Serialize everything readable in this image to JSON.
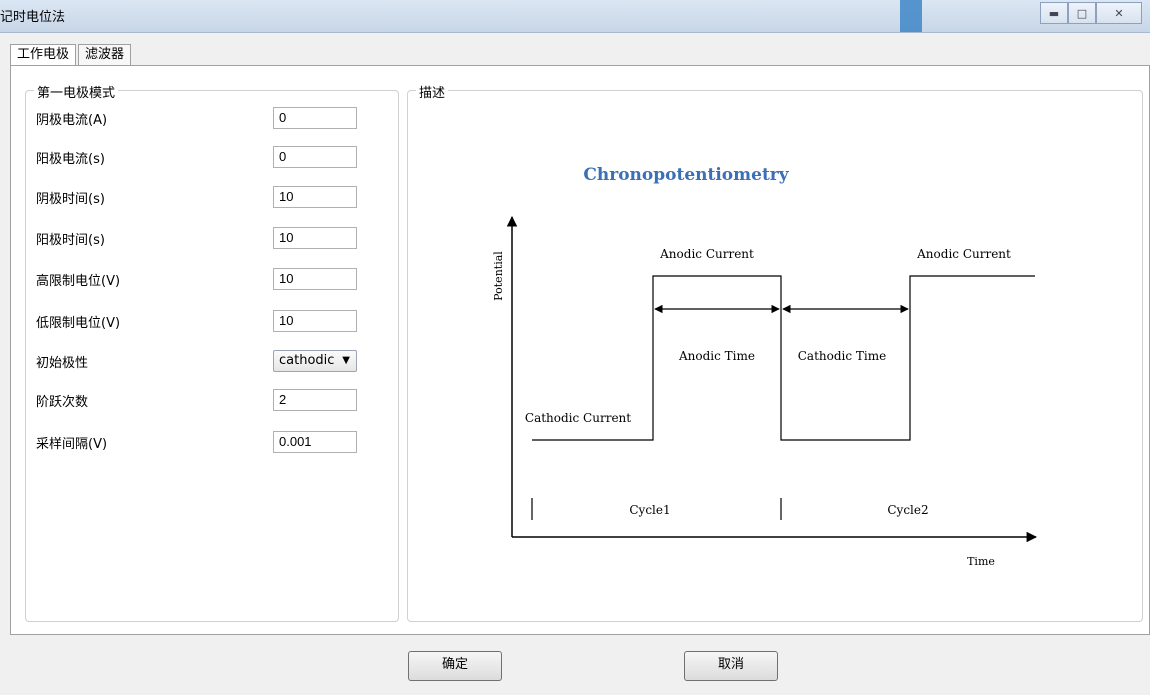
{
  "window": {
    "title": "记时电位法"
  },
  "tabs": [
    {
      "label": "工作电极"
    },
    {
      "label": "滤波器"
    }
  ],
  "left_group": {
    "title": "第一电极模式",
    "fields": [
      {
        "label": "阴极电流(A)",
        "value": "0"
      },
      {
        "label": "阳极电流(s)",
        "value": "0"
      },
      {
        "label": "阴极时间(s)",
        "value": "10"
      },
      {
        "label": "阳极时间(s)",
        "value": "10"
      },
      {
        "label": "高限制电位(V)",
        "value": "10"
      },
      {
        "label": "低限制电位(V)",
        "value": "10"
      },
      {
        "label": "初始极性",
        "value": "cathodic"
      },
      {
        "label": "阶跃次数",
        "value": "2"
      },
      {
        "label": "采样间隔(V)",
        "value": "0.001"
      }
    ]
  },
  "right_group": {
    "title": "描述",
    "diagram": {
      "title": "Chronopotentiometry",
      "y_axis_label": "Potential",
      "x_axis_label": "Time",
      "labels": {
        "anodic_current_1": "Anodic Current",
        "anodic_current_2": "Anodic Current",
        "cathodic_current": "Cathodic Current",
        "anodic_time": "Anodic Time",
        "cathodic_time": "Cathodic Time",
        "cycle1": "Cycle1",
        "cycle2": "Cycle2"
      },
      "title_color": "#3b6fb6"
    }
  },
  "buttons": {
    "ok": "确定",
    "cancel": "取消"
  }
}
